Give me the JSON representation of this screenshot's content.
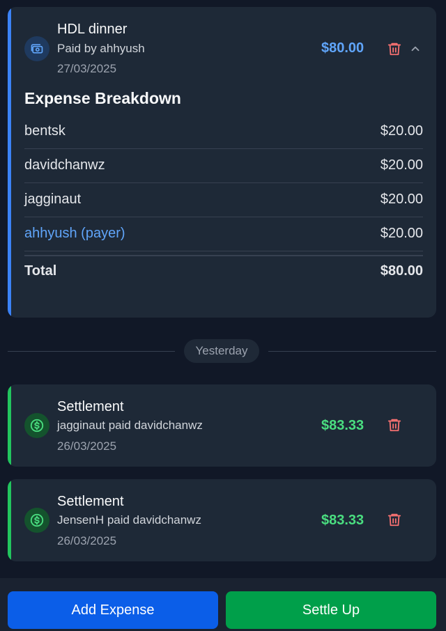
{
  "expense": {
    "title": "HDL dinner",
    "paid_by": "Paid by ahhyush",
    "date": "27/03/2025",
    "amount": "$80.00",
    "breakdown_title": "Expense Breakdown",
    "rows": [
      {
        "name": "bentsk",
        "value": "$20.00"
      },
      {
        "name": "davidchanwz",
        "value": "$20.00"
      },
      {
        "name": "jagginaut",
        "value": "$20.00"
      },
      {
        "name": "ahhyush (payer)",
        "value": "$20.00"
      }
    ],
    "total_label": "Total",
    "total_value": "$80.00",
    "icon": "money-icon",
    "accent": "#3b82f6"
  },
  "divider": {
    "label": "Yesterday"
  },
  "settlements": [
    {
      "title": "Settlement",
      "description": "jagginaut paid davidchanwz",
      "date": "26/03/2025",
      "amount": "$83.33",
      "icon": "dollar-icon"
    },
    {
      "title": "Settlement",
      "description": "JensenH paid davidchanwz",
      "date": "26/03/2025",
      "amount": "$83.33",
      "icon": "dollar-icon"
    }
  ],
  "footer": {
    "add_label": "Add Expense",
    "settle_label": "Settle Up"
  },
  "colors": {
    "blue": "#3b82f6",
    "green": "#22c55e",
    "delete": "#f87171"
  }
}
